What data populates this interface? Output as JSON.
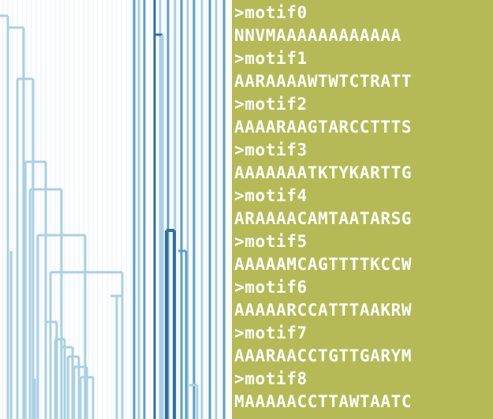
{
  "motifs": [
    {
      "header": ">motif0",
      "sequence": "NNVMAAAAAAAAAAAA"
    },
    {
      "header": ">motif1",
      "sequence": "AARAAAAWTWTCTRATT"
    },
    {
      "header": ">motif2",
      "sequence": "AAAARAAGTARCCTTTS"
    },
    {
      "header": ">motif3",
      "sequence": "AAAAAAATKTYKARTTG"
    },
    {
      "header": ">motif4",
      "sequence": "ARAAAACAMTAATARSG"
    },
    {
      "header": ">motif5",
      "sequence": "AAAAAMCAGTTTTKCCW"
    },
    {
      "header": ">motif6",
      "sequence": "AAAAARCCATTTAAKRW"
    },
    {
      "header": ">motif7",
      "sequence": "AAARAACCTGTTGARYM"
    },
    {
      "header": ">motif8",
      "sequence": "MAAAAACCTTAWTAATC"
    }
  ],
  "colors": {
    "panel_background": "#b5ba56",
    "branch_light": "#a9d0e4",
    "branch_medium": "#5f9fc6",
    "branch_dark": "#2f6f9f",
    "text": "#ffffff"
  }
}
